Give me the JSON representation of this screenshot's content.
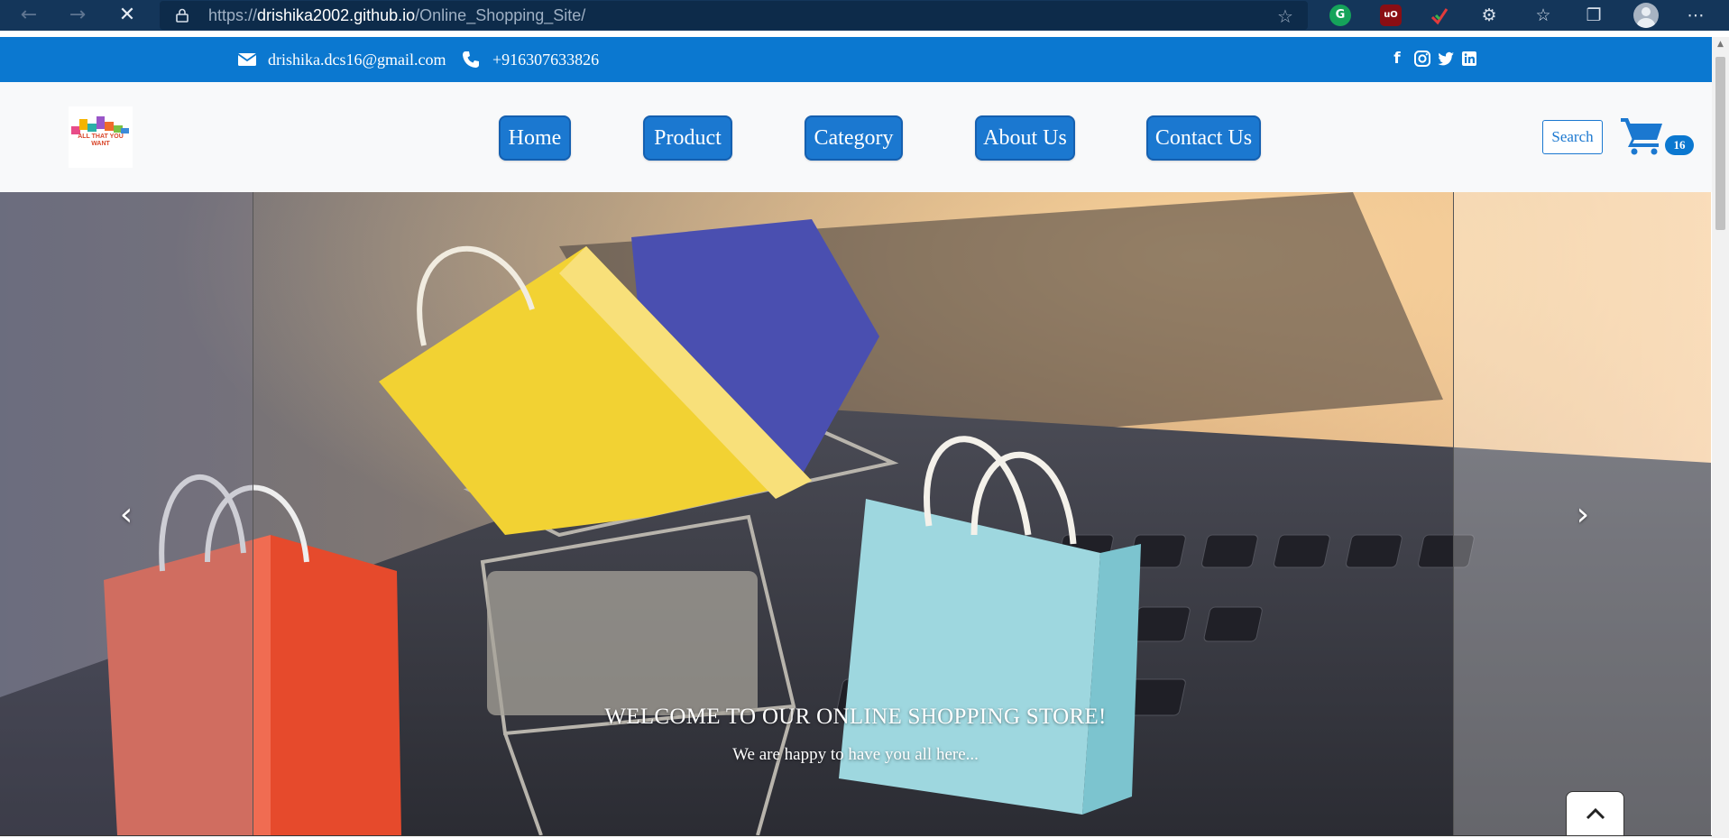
{
  "browser": {
    "url_prefix": "https://",
    "url_host": "drishika2002.github.io",
    "url_path": "/Online_Shopping_Site/"
  },
  "topbar": {
    "email": "drishika.dcs16@gmail.com",
    "phone": "+916307633826",
    "social_icons": [
      "facebook-icon",
      "instagram-icon",
      "twitter-icon",
      "linkedin-icon"
    ]
  },
  "header": {
    "logo_text": "ALL THAT YOU WANT",
    "nav": [
      {
        "label": "Home"
      },
      {
        "label": "Product"
      },
      {
        "label": "Category"
      },
      {
        "label": "About Us"
      },
      {
        "label": "Contact Us"
      }
    ],
    "search_label": "Search",
    "cart_count": "16"
  },
  "carousel": {
    "title": "WELCOME TO OUR ONLINE SHOPPING STORE!",
    "subtitle": "We are happy to have you all here..."
  },
  "colors": {
    "primary": "#0b78d0",
    "browser_bar": "#14365a",
    "header_bg": "#f8f9fa"
  }
}
